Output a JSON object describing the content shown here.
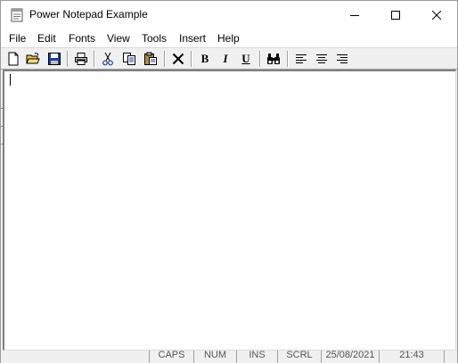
{
  "window": {
    "title": "Power Notepad Example"
  },
  "menubar": {
    "items": [
      "File",
      "Edit",
      "Fonts",
      "View",
      "Tools",
      "Insert",
      "Help"
    ]
  },
  "toolbar": {
    "buttons": [
      "new-file-icon",
      "open-folder-icon",
      "save-icon",
      "print-icon",
      "cut-icon",
      "copy-icon",
      "paste-icon",
      "delete-icon",
      "bold",
      "italic",
      "underline",
      "find-icon",
      "align-left-icon",
      "align-center-icon",
      "align-right-icon"
    ],
    "bold_label": "B",
    "italic_label": "I",
    "underline_label": "U"
  },
  "editor": {
    "content": ""
  },
  "statusbar": {
    "caps": "CAPS",
    "num": "NUM",
    "ins": "INS",
    "scrl": "SCRL",
    "date": "25/08/2021",
    "time": "21:43"
  },
  "colors": {
    "titlebar_bg": "#ffffff",
    "chrome_bg": "#f0f0f0",
    "editor_bg": "#ffffff",
    "icon_yellow": "#e8c44a",
    "icon_blue": "#1f3f9f"
  }
}
